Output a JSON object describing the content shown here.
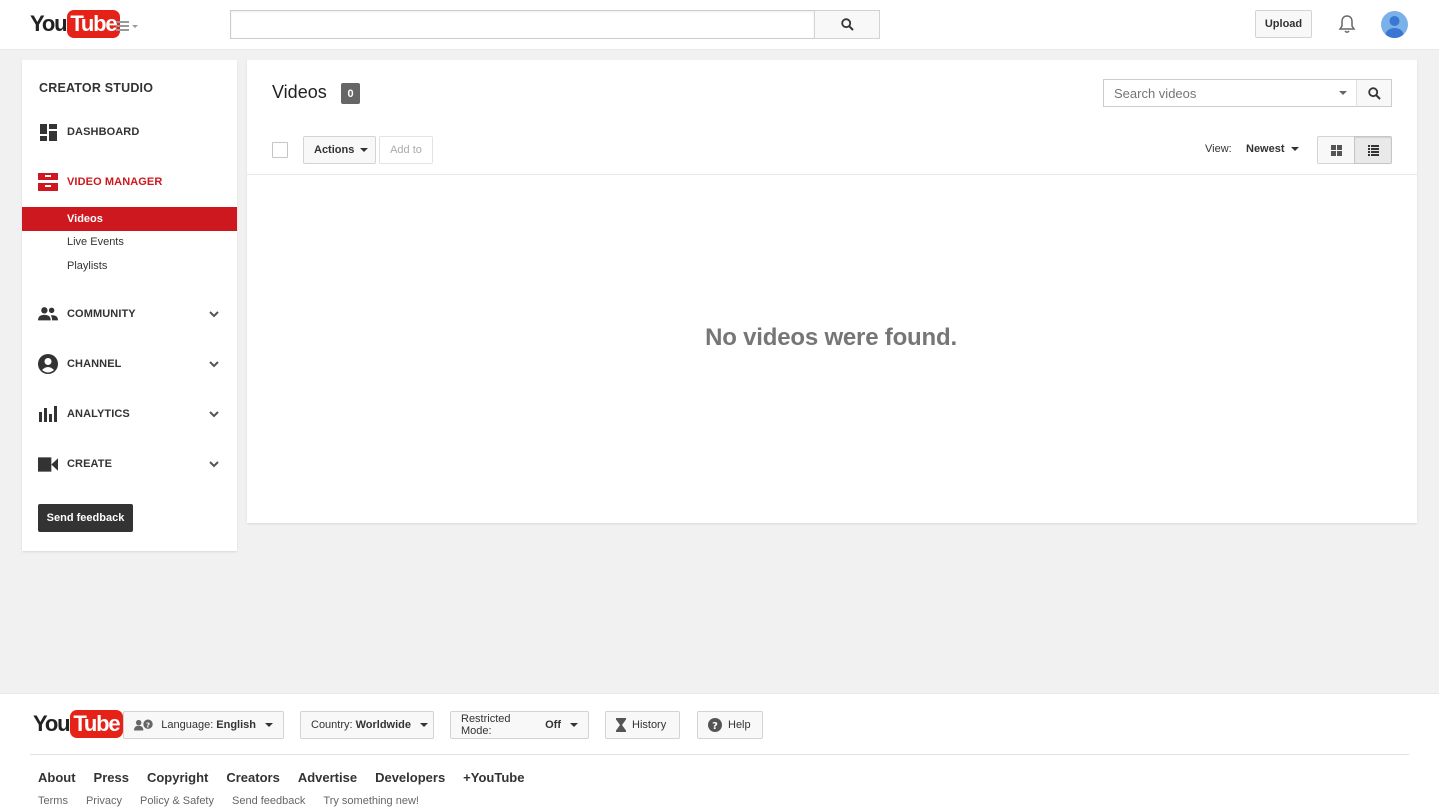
{
  "masthead": {
    "logo_you": "You",
    "logo_tube": "Tube",
    "search_value": "",
    "upload_label": "Upload"
  },
  "sidebar": {
    "title": "CREATOR STUDIO",
    "items": [
      {
        "label": "DASHBOARD",
        "icon": "dashboard-icon"
      },
      {
        "label": "VIDEO MANAGER",
        "icon": "video-manager-icon",
        "active": true
      },
      {
        "label": "COMMUNITY",
        "icon": "community-icon"
      },
      {
        "label": "CHANNEL",
        "icon": "channel-icon"
      },
      {
        "label": "ANALYTICS",
        "icon": "analytics-icon"
      },
      {
        "label": "CREATE",
        "icon": "create-icon"
      }
    ],
    "subitems": [
      {
        "label": "Videos",
        "selected": true
      },
      {
        "label": "Live Events"
      },
      {
        "label": "Playlists"
      }
    ],
    "feedback_label": "Send feedback"
  },
  "main": {
    "title": "Videos",
    "count": "0",
    "search_placeholder": "Search videos",
    "actions_label": "Actions",
    "addto_label": "Add to",
    "view_label": "View:",
    "sort_value": "Newest",
    "empty_message": "No videos were found."
  },
  "footer": {
    "language_label": "Language:",
    "language_value": "English",
    "country_label": "Country:",
    "country_value": "Worldwide",
    "restricted_label": "Restricted Mode:",
    "restricted_value": "Off",
    "history_label": "History",
    "help_label": "Help",
    "primary_links": [
      "About",
      "Press",
      "Copyright",
      "Creators",
      "Advertise",
      "Developers",
      "+YouTube"
    ],
    "secondary_links": [
      "Terms",
      "Privacy",
      "Policy & Safety",
      "Send feedback",
      "Try something new!"
    ]
  },
  "colors": {
    "brand_red": "#e62117",
    "active_red": "#cc181e",
    "dark_button": "#333333"
  }
}
